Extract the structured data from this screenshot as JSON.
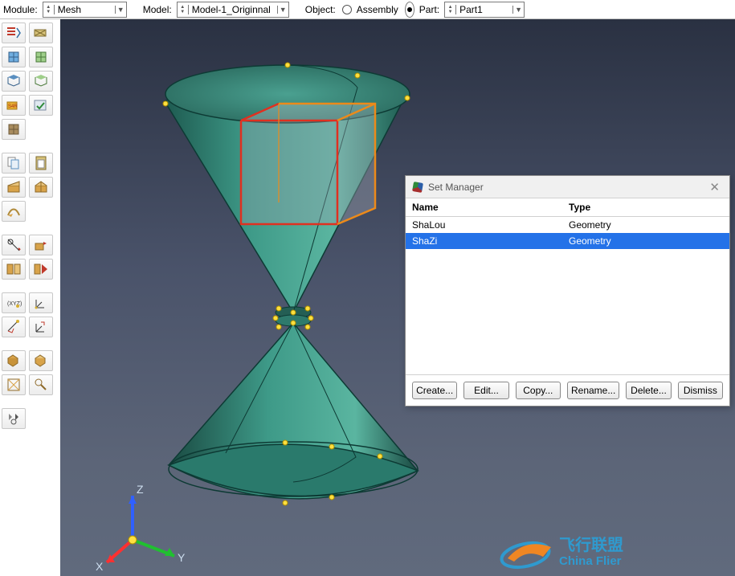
{
  "topbar": {
    "module_label": "Module:",
    "module_value": "Mesh",
    "model_label": "Model:",
    "model_value": "Model-1_Originnal",
    "object_label": "Object:",
    "assembly_label": "Assembly",
    "part_label": "Part:",
    "part_value": "Part1",
    "object_mode": "Part"
  },
  "palette": {
    "tools": [
      "seed-part-icon",
      "seed-edges-icon",
      "mesh-part-icon",
      "mesh-region-icon",
      "assign-mesh-controls-icon",
      "assign-element-type-icon",
      "mesh-controls-s4r-icon",
      "verify-mesh-icon",
      "bottom-up-mesh-icon",
      "",
      "",
      "",
      "copy-icon",
      "paste-icon",
      "partition-face-icon",
      "partition-cell-icon",
      "sweep-icon",
      "",
      "",
      "",
      "query-icon",
      "edit-icon",
      "swap-icon",
      "merge-icon",
      "",
      "",
      "datum-xyz-icon",
      "datum-csys-icon",
      "datum-plane-icon",
      "datum-axis-icon",
      "",
      "",
      "extrude-icon",
      "revolve-icon",
      "sketch-icon",
      "repair-icon",
      "",
      "",
      "tools-icon",
      ""
    ]
  },
  "triad": {
    "x": "X",
    "y": "Y",
    "z": "Z"
  },
  "dialog": {
    "title": "Set Manager",
    "columns": {
      "name": "Name",
      "type": "Type"
    },
    "rows": [
      {
        "name": "ShaLou",
        "type": "Geometry",
        "selected": false
      },
      {
        "name": "ShaZi",
        "type": "Geometry",
        "selected": true
      }
    ],
    "buttons": {
      "create": "Create...",
      "edit": "Edit...",
      "copy": "Copy...",
      "rename": "Rename...",
      "delete": "Delete...",
      "dismiss": "Dismiss"
    }
  },
  "watermark": {
    "line1": "飞行联盟",
    "line2": "China Flier"
  }
}
